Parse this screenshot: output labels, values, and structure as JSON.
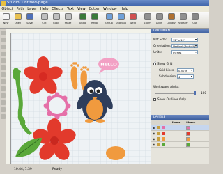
{
  "window": {
    "title": "Studio: Untitled-page1"
  },
  "menu": [
    "Object",
    "Path",
    "Layer",
    "Help",
    "Effects",
    "Text",
    "View",
    "Cutter",
    "Window",
    "Help"
  ],
  "toolbar": [
    {
      "label": "New",
      "color": "#f4f4f4"
    },
    {
      "label": "Open",
      "color": "#e8c050"
    },
    {
      "label": "Save",
      "color": "#5070b8"
    },
    {
      "label": "Cut",
      "color": "#c0c0c0"
    },
    {
      "label": "Copy",
      "color": "#c0c0c0"
    },
    {
      "label": "Paste",
      "color": "#c0c0c0"
    },
    {
      "label": "Undo",
      "color": "#3a7a3a"
    },
    {
      "label": "Redo",
      "color": "#3a7a3a"
    },
    {
      "label": "Group",
      "color": "#6fa0d8"
    },
    {
      "label": "Ungroup",
      "color": "#6fa0d8"
    },
    {
      "label": "Weld",
      "color": "#d05050"
    },
    {
      "label": "Zoom",
      "color": "#909090"
    },
    {
      "label": "Align",
      "color": "#909090"
    },
    {
      "label": "Library",
      "color": "#b07030"
    },
    {
      "label": "Register",
      "color": "#909090"
    },
    {
      "label": "Cut",
      "color": "#888888"
    }
  ],
  "canvas": {
    "speech_bubble_text": "HELLO",
    "colors": {
      "grid": "#dfe6ed",
      "red": "#e23a2c",
      "green": "#5aa83a",
      "pink": "#e56fa8",
      "orange": "#f09a3e",
      "navy": "#2e3e5c"
    }
  },
  "document_panel": {
    "header": "DOCUMENT",
    "mat_size_label": "Mat Size:",
    "mat_size_value": "12\" x 12\"",
    "orientation_label": "Orientation:",
    "orientation_value": "Vertical (Portrait)",
    "units_label": "Units:",
    "units_value": "Inches",
    "show_grid_label": "Show Grid",
    "grid_lines_label": "Grid Lines:",
    "grid_lines_value": "0.50 in",
    "subdivision_label": "Subdivision:",
    "subdivision_value": "4",
    "workspace_alpha_label": "Workspace Alpha:",
    "workspace_alpha_value": "100",
    "outlines_only_label": "Show Outlines Only"
  },
  "layers_panel": {
    "header": "LAYERS",
    "col_name": "Name",
    "col_shape": "Shape",
    "rows": [
      {
        "name": "",
        "color": "#e56fa8"
      },
      {
        "name": "",
        "color": "#e23a2c"
      },
      {
        "name": "",
        "color": "#f09a3e"
      },
      {
        "name": "",
        "color": "#5aa83a"
      }
    ]
  },
  "status": {
    "coordinates": "10.44, 1.39",
    "ready": "Ready"
  }
}
